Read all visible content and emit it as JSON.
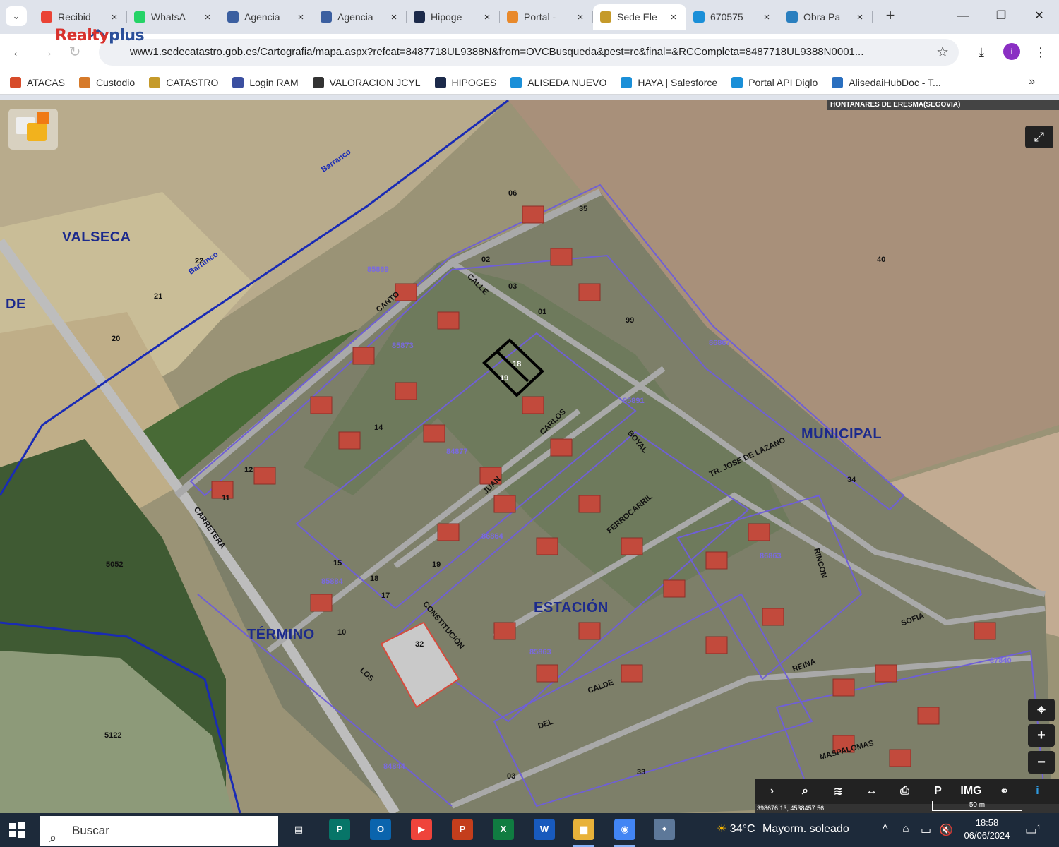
{
  "browser": {
    "tabs": [
      {
        "label": "Recibid",
        "icon": "gmail-icon",
        "color": "#ea4335",
        "active": false
      },
      {
        "label": "WhatsA",
        "icon": "whatsapp-icon",
        "color": "#25d366",
        "active": false
      },
      {
        "label": "Agencia",
        "icon": "agency-icon",
        "color": "#3b5fa0",
        "active": false
      },
      {
        "label": "Agencia",
        "icon": "agency-icon",
        "color": "#3b5fa0",
        "active": false
      },
      {
        "label": "Hipoge",
        "icon": "hipoges-icon",
        "color": "#1c2a4a",
        "active": false
      },
      {
        "label": "Portal -",
        "icon": "portal-icon",
        "color": "#e8892b",
        "active": false
      },
      {
        "label": "Sede Ele",
        "icon": "catastro-icon",
        "color": "#c59a2a",
        "active": true
      },
      {
        "label": "670575",
        "icon": "salesforce-icon",
        "color": "#1a8fd8",
        "active": false
      },
      {
        "label": "Obra Pa",
        "icon": "obra-icon",
        "color": "#2a7fbf",
        "active": false
      }
    ],
    "new_tab_label": "+",
    "window_controls": {
      "minimize": "—",
      "maximize": "❐",
      "close": "✕"
    },
    "url": "www1.sedecatastro.gob.es/Cartografia/mapa.aspx?refcat=8487718UL9388N&from=OVCBusqueda&pest=rc&final=&RCCompleta=8487718UL9388N0001...",
    "brand_overlay": {
      "main": "Realty",
      "suffix": "plus"
    },
    "profile_initial": "i",
    "bookmarks": [
      {
        "label": "ATACAS",
        "color": "#d74b2a"
      },
      {
        "label": "Custodio",
        "color": "#d67a2a"
      },
      {
        "label": "CATASTRO",
        "color": "#c59a2a"
      },
      {
        "label": "Login RAM",
        "color": "#3b4fa0"
      },
      {
        "label": "VALORACION JCYL",
        "color": "#333333"
      },
      {
        "label": "HIPOGES",
        "color": "#1c2a4a"
      },
      {
        "label": "ALISEDA NUEVO",
        "color": "#1a8fd8"
      },
      {
        "label": "HAYA | Salesforce",
        "color": "#1a8fd8"
      },
      {
        "label": "Portal API Diglo",
        "color": "#1a8fd8"
      },
      {
        "label": "AlisedaiHubDoc - T...",
        "color": "#2a6fbf"
      }
    ],
    "bookmarks_more": "»"
  },
  "map": {
    "municipality": "HONTANARES DE ERESMA(SEGOVIA)",
    "area_labels": [
      {
        "text": "VALSECA"
      },
      {
        "text": "DE"
      },
      {
        "text": "MUNICIPAL"
      },
      {
        "text": "TÉRMINO"
      },
      {
        "text": "ESTACIÓN"
      }
    ],
    "street_labels": [
      {
        "text": "Barranco"
      },
      {
        "text": "Barranco"
      },
      {
        "text": "CALLE"
      },
      {
        "text": "CANTO"
      },
      {
        "text": "CARLOS"
      },
      {
        "text": "JUAN"
      },
      {
        "text": "CONSTITUCIÓN"
      },
      {
        "text": "CARRETERA"
      },
      {
        "text": "BOYAL"
      },
      {
        "text": "FERROCARRIL"
      },
      {
        "text": "TR. JOSE DE LAZANO"
      },
      {
        "text": "RINCON"
      },
      {
        "text": "REINA"
      },
      {
        "text": "SOFIA"
      },
      {
        "text": "MASPALOMAS"
      },
      {
        "text": "LOS"
      },
      {
        "text": "DEL"
      },
      {
        "text": "CALDE"
      }
    ],
    "parcel_numbers": [
      {
        "text": "40"
      },
      {
        "text": "34"
      },
      {
        "text": "35"
      },
      {
        "text": "06"
      },
      {
        "text": "02"
      },
      {
        "text": "03"
      },
      {
        "text": "01"
      },
      {
        "text": "99"
      },
      {
        "text": "22"
      },
      {
        "text": "21"
      },
      {
        "text": "20"
      },
      {
        "text": "5052"
      },
      {
        "text": "5122"
      },
      {
        "text": "32"
      },
      {
        "text": "33"
      },
      {
        "text": "03"
      },
      {
        "text": "18"
      },
      {
        "text": "19"
      },
      {
        "text": "17"
      },
      {
        "text": "15"
      },
      {
        "text": "14"
      },
      {
        "text": "12"
      },
      {
        "text": "11"
      },
      {
        "text": "10"
      }
    ],
    "block_ids": [
      {
        "text": "85869"
      },
      {
        "text": "85873"
      },
      {
        "text": "84877"
      },
      {
        "text": "85891"
      },
      {
        "text": "86864"
      },
      {
        "text": "86863"
      },
      {
        "text": "85884"
      },
      {
        "text": "84844"
      },
      {
        "text": "85863"
      },
      {
        "text": "86867"
      },
      {
        "text": "87840"
      }
    ],
    "selected_parcels": [
      {
        "text": "18"
      },
      {
        "text": "19"
      }
    ],
    "controls": {
      "fullscreen": "⤢",
      "locate": "⌖",
      "zoom_in": "+",
      "zoom_out": "−"
    },
    "tools": [
      {
        "label": "›",
        "icon": "chevron-right-icon"
      },
      {
        "label": "⌕",
        "icon": "search-icon"
      },
      {
        "label": "≋",
        "icon": "layers-icon"
      },
      {
        "label": "↔",
        "icon": "measure-icon"
      },
      {
        "label": "⎙",
        "icon": "print-icon"
      },
      {
        "label": "P",
        "icon": "parking-icon"
      },
      {
        "label": "IMG",
        "icon": "image-icon"
      },
      {
        "label": "⚭",
        "icon": "street-view-icon"
      },
      {
        "label": "i",
        "icon": "info-icon"
      }
    ],
    "coordinates": "398676.13, 4538457.56",
    "scale_label": "50 m"
  },
  "taskbar": {
    "search_placeholder": "Buscar",
    "apps": [
      {
        "label": "▤",
        "icon": "task-view-icon",
        "color": "transparent"
      },
      {
        "label": "P",
        "icon": "publisher-icon",
        "color": "#077568"
      },
      {
        "label": "O",
        "icon": "outlook-icon",
        "color": "#0a64ad"
      },
      {
        "label": "▶",
        "icon": "anydesk-icon",
        "color": "#ef443b"
      },
      {
        "label": "P",
        "icon": "powerpoint-icon",
        "color": "#c43e1c"
      },
      {
        "label": "X",
        "icon": "excel-icon",
        "color": "#107c41"
      },
      {
        "label": "W",
        "icon": "word-icon",
        "color": "#185abd"
      },
      {
        "label": "▆",
        "icon": "file-explorer-icon",
        "color": "#e8b23a"
      },
      {
        "label": "◉",
        "icon": "chrome-icon",
        "color": "#4285f4"
      },
      {
        "label": "✦",
        "icon": "app-icon",
        "color": "#5d7899"
      }
    ],
    "weather": {
      "temp": "34°C",
      "desc": "Mayorm. soleado"
    },
    "tray": [
      "^",
      "⌂",
      "▭",
      "🔇"
    ],
    "time": "18:58",
    "date": "06/06/2024",
    "notifications": "1"
  }
}
